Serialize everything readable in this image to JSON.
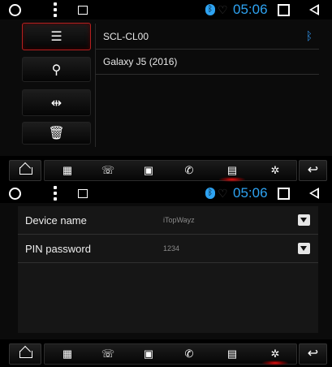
{
  "status": {
    "time": "05:06"
  },
  "bluetooth_screen": {
    "side_buttons": [
      {
        "id": "list",
        "glyph": "☰"
      },
      {
        "id": "search",
        "glyph": "⚲"
      },
      {
        "id": "pair",
        "glyph": "⇹"
      },
      {
        "id": "delete",
        "glyph": "🗑"
      }
    ],
    "devices": [
      {
        "name": "SCL-CL00",
        "connected": true,
        "icon": "bluetooth-icon"
      },
      {
        "name": "Galaxy J5 (2016)",
        "connected": false
      }
    ]
  },
  "settings_screen": {
    "rows": [
      {
        "label": "Device name",
        "value": "iTopWayz"
      },
      {
        "label": "PIN password",
        "value": "1234"
      }
    ]
  },
  "navbar": {
    "items": [
      {
        "id": "keypad",
        "glyph": "▦"
      },
      {
        "id": "call-log",
        "glyph": "☏"
      },
      {
        "id": "contacts",
        "glyph": "▣"
      },
      {
        "id": "phone",
        "glyph": "✆"
      },
      {
        "id": "music",
        "glyph": "▤"
      },
      {
        "id": "settings",
        "glyph": "✲"
      }
    ],
    "back_glyph": "↩"
  },
  "colors": {
    "accent": "#2ea3f2",
    "active_red": "#e11111"
  }
}
